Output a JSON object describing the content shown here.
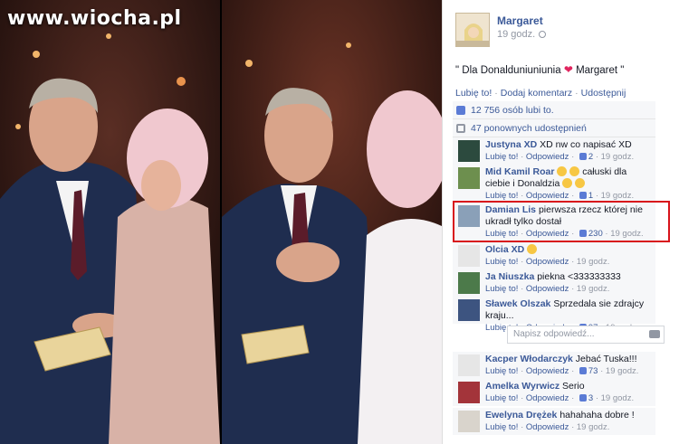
{
  "watermark": "www.wiocha.pl",
  "post": {
    "author": "Margaret",
    "time": "19 godz.",
    "text_prefix": "\" Dla Donalduniuniunia",
    "text_suffix": "Margaret \"",
    "actions": [
      "Lubię to!",
      "Dodaj komentarz",
      "Udostępnij"
    ],
    "likes": "12 756 osób lubi to.",
    "shares": "47 ponownych udostępnień"
  },
  "comments": [
    {
      "name": "Justyna XD",
      "text": "XD nw co napisać XD",
      "like": "Lubię to!",
      "reply": "Odpowiedz",
      "count": "2",
      "time": "19 godz."
    },
    {
      "name": "Mid Kamil Roar",
      "text": "całuski dla ciebie i Donaldzia",
      "like": "Lubię to!",
      "reply": "Odpowiedz",
      "count": "1",
      "time": "19 godz."
    },
    {
      "name": "Damian Lis",
      "text": "pierwsza rzecz której nie ukradł tylko dostał",
      "like": "Lubię to!",
      "reply": "Odpowiedz",
      "count": "230",
      "time": "19 godz."
    },
    {
      "name": "Olcia XD",
      "text": "",
      "like": "Lubię to!",
      "reply": "Odpowiedz",
      "count": "",
      "time": "19 godz."
    },
    {
      "name": "Ja Niuszka",
      "text": "piekna <333333333",
      "like": "Lubię to!",
      "reply": "Odpowiedz",
      "count": "",
      "time": "19 godz."
    },
    {
      "name": "Sławek Olszak",
      "text": "Sprzedala sie zdrajcy kraju...",
      "like": "Lubię to!",
      "reply": "Odpowiedz",
      "count": "97",
      "time": "19 godz."
    },
    {
      "name": "Kacper Włodarczyk",
      "text": "Jebać Tuska!!!",
      "like": "Lubię to!",
      "reply": "Odpowiedz",
      "count": "73",
      "time": "19 godz."
    },
    {
      "name": "Amelka Wyrwicz",
      "text": "Serio",
      "like": "Lubię to!",
      "reply": "Odpowiedz",
      "count": "3",
      "time": "19 godz."
    },
    {
      "name": "Ewelyna Drężek",
      "text": "hahahaha dobre !",
      "like": "Lubię to!",
      "reply": "Odpowiedz",
      "count": "",
      "time": "19 godz."
    }
  ],
  "reply_placeholder": "Napisz odpowiedź..."
}
